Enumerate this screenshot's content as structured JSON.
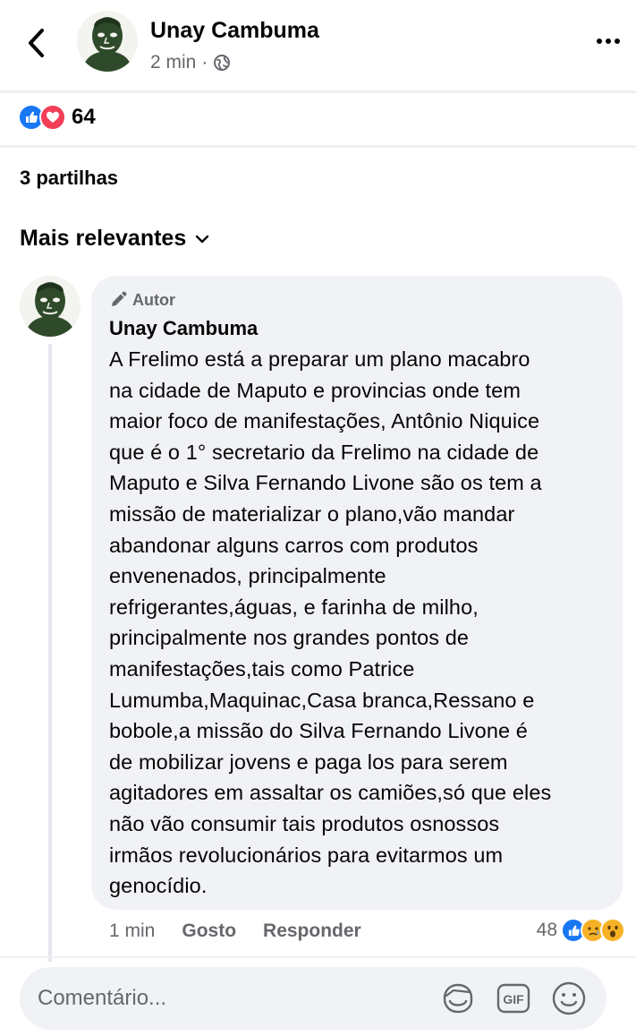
{
  "header": {
    "author_name": "Unay Cambuma",
    "time": "2 min",
    "separator": "·",
    "privacy_icon": "globe-icon",
    "back_icon": "chevron-left-icon",
    "more_icon": "more-dots-icon"
  },
  "reactions": {
    "icons": [
      "like-icon",
      "love-icon"
    ],
    "count": "64"
  },
  "shares": {
    "label": "3 partilhas"
  },
  "sort": {
    "label": "Mais relevantes",
    "icon": "chevron-down-icon"
  },
  "comment": {
    "badge_label": "Autor",
    "badge_icon": "pen-icon",
    "author": "Unay Cambuma",
    "text": "A Frelimo está a preparar um plano macabro\nna cidade de Maputo e provincias onde tem\nmaior foco de manifestações, Antônio Niquice\nque é o 1° secretario da Frelimo na cidade de\nMaputo e Silva Fernando Livone são os tem a\nmissão de  materializar o plano,vão mandar\nabandonar alguns carros com produtos\nenvenenados, principalmente\nrefrigerantes,águas, e farinha de milho,\nprincipalmente nos grandes pontos de\nmanifestações,tais como Patrice\nLumumba,Maquinac,Casa branca,Ressano e\nbobole,a missão do Silva Fernando Livone é\nde mobilizar jovens e paga los para serem\nagitadores em assaltar os camiões,só que eles\nnão vão consumir tais produtos osnossos\nirmãos revolucionários para evitarmos um\ngenocídio.",
    "time": "1 min",
    "like_label": "Gosto",
    "reply_label": "Responder",
    "reaction_count": "48",
    "reaction_icons": [
      "like-icon",
      "sad-icon",
      "wow-icon"
    ]
  },
  "composer": {
    "placeholder": "Comentário...",
    "icons": [
      "sticker-icon",
      "gif-icon",
      "emoji-icon"
    ],
    "gif_label": "GIF"
  },
  "colors": {
    "text": "#050505",
    "secondary": "#65676b",
    "bubble": "#f0f2f5",
    "like_blue": "#1877f2",
    "love_red": "#f33e58",
    "haha_yellow": "#f7b125"
  }
}
